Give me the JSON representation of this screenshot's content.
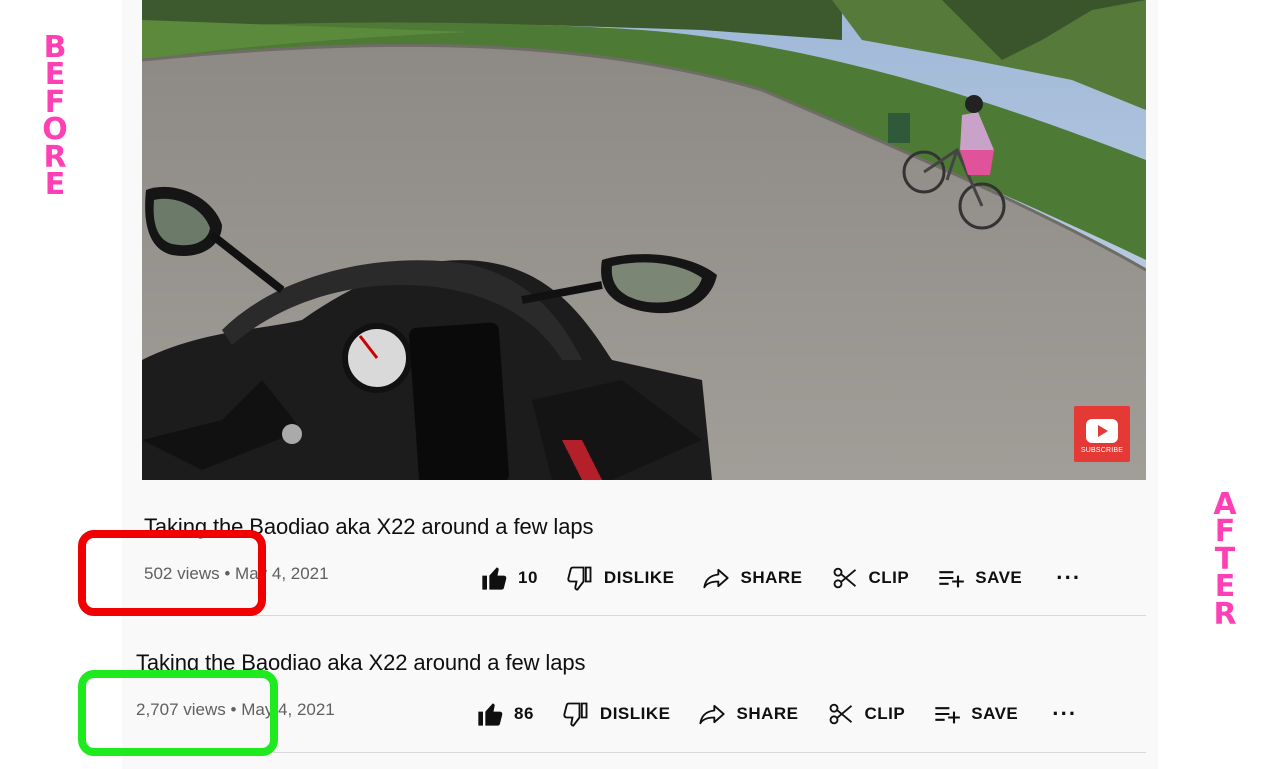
{
  "labels": {
    "before": [
      "B",
      "E",
      "F",
      "O",
      "R",
      "E"
    ],
    "after": [
      "A",
      "F",
      "T",
      "E",
      "R"
    ]
  },
  "video": {
    "subscribe_badge_text": "SUBSCRIBE"
  },
  "before": {
    "title": "Taking the Baodiao aka X22 around a few laps",
    "views": "502 views",
    "separator": "•",
    "date": "May 4, 2021",
    "likes": "10",
    "dislike_label": "DISLIKE",
    "share_label": "SHARE",
    "clip_label": "CLIP",
    "save_label": "SAVE",
    "more": "···"
  },
  "after": {
    "title": "Taking the Baodiao aka X22 around a few laps",
    "views": "2,707 views",
    "separator": "•",
    "date": "May 4, 2021",
    "likes": "86",
    "dislike_label": "DISLIKE",
    "share_label": "SHARE",
    "clip_label": "CLIP",
    "save_label": "SAVE",
    "more": "···"
  },
  "colors": {
    "label_pink": "#ff3fb4",
    "highlight_red": "#f00000",
    "highlight_green": "#1fea1f",
    "youtube_red": "#e53935"
  }
}
